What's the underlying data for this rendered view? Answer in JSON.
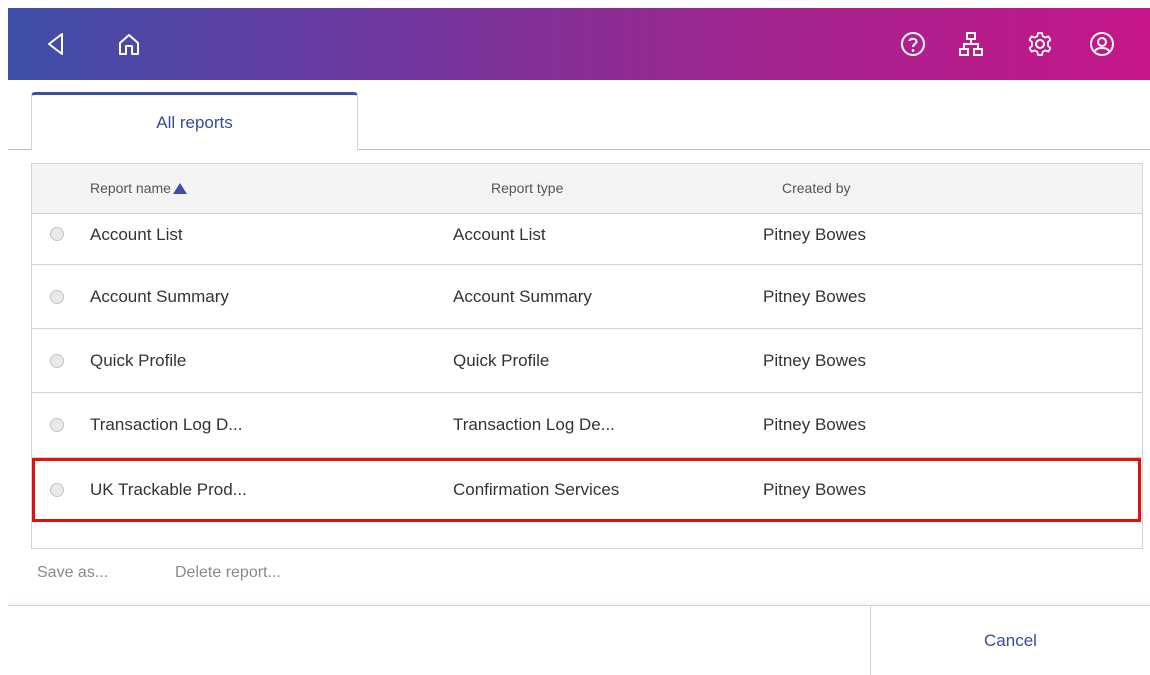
{
  "header": {
    "icons": [
      "back-icon",
      "home-icon",
      "help-icon",
      "network-icon",
      "settings-icon",
      "account-icon"
    ],
    "gradient_colors": [
      "#3d4fa8",
      "#c6168a"
    ]
  },
  "tabs": [
    {
      "label": "All reports",
      "active": true
    }
  ],
  "table": {
    "headers": {
      "name": "Report name",
      "type": "Report type",
      "creator": "Created by"
    },
    "sort": {
      "column": "name",
      "direction": "ascending"
    },
    "rows": [
      {
        "name": "Account List",
        "type": "Account List",
        "creator": "Pitney Bowes",
        "selected": false
      },
      {
        "name": "Account Summary",
        "type": "Account Summary",
        "creator": "Pitney Bowes",
        "selected": false
      },
      {
        "name": "Quick Profile",
        "type": "Quick Profile",
        "creator": "Pitney Bowes",
        "selected": false
      },
      {
        "name": "Transaction Log D...",
        "type": "Transaction Log De...",
        "creator": "Pitney Bowes",
        "selected": false
      },
      {
        "name": "UK Trackable Prod...",
        "type": "Confirmation Services",
        "creator": "Pitney Bowes",
        "selected": false,
        "highlighted": true
      }
    ]
  },
  "actions": {
    "save_as": "Save as...",
    "delete": "Delete report..."
  },
  "footer": {
    "cancel": "Cancel"
  },
  "colors": {
    "accent": "#3e4fa8",
    "highlight_border": "#e01010"
  }
}
